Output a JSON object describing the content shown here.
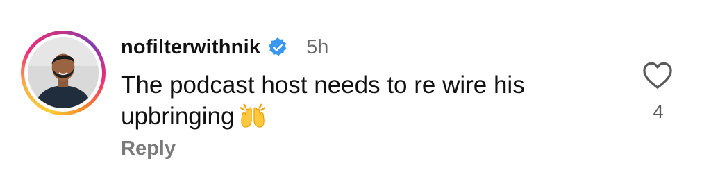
{
  "comment": {
    "username": "nofilterwithnik",
    "verified": true,
    "timestamp": "5h",
    "text": "The podcast host needs to re wire his upbringing",
    "emoji": "raising-hands",
    "reply_label": "Reply",
    "like_count": "4"
  },
  "colors": {
    "verified_badge": "#3897f0",
    "username_text": "#111111",
    "meta_text": "#6b6b6b",
    "reply_text": "#7a7a7a",
    "heart_outline": "#5a5a5a"
  },
  "icons": {
    "verified": "verified-badge-icon",
    "like": "heart-outline-icon",
    "emoji": "raising-hands-emoji"
  }
}
